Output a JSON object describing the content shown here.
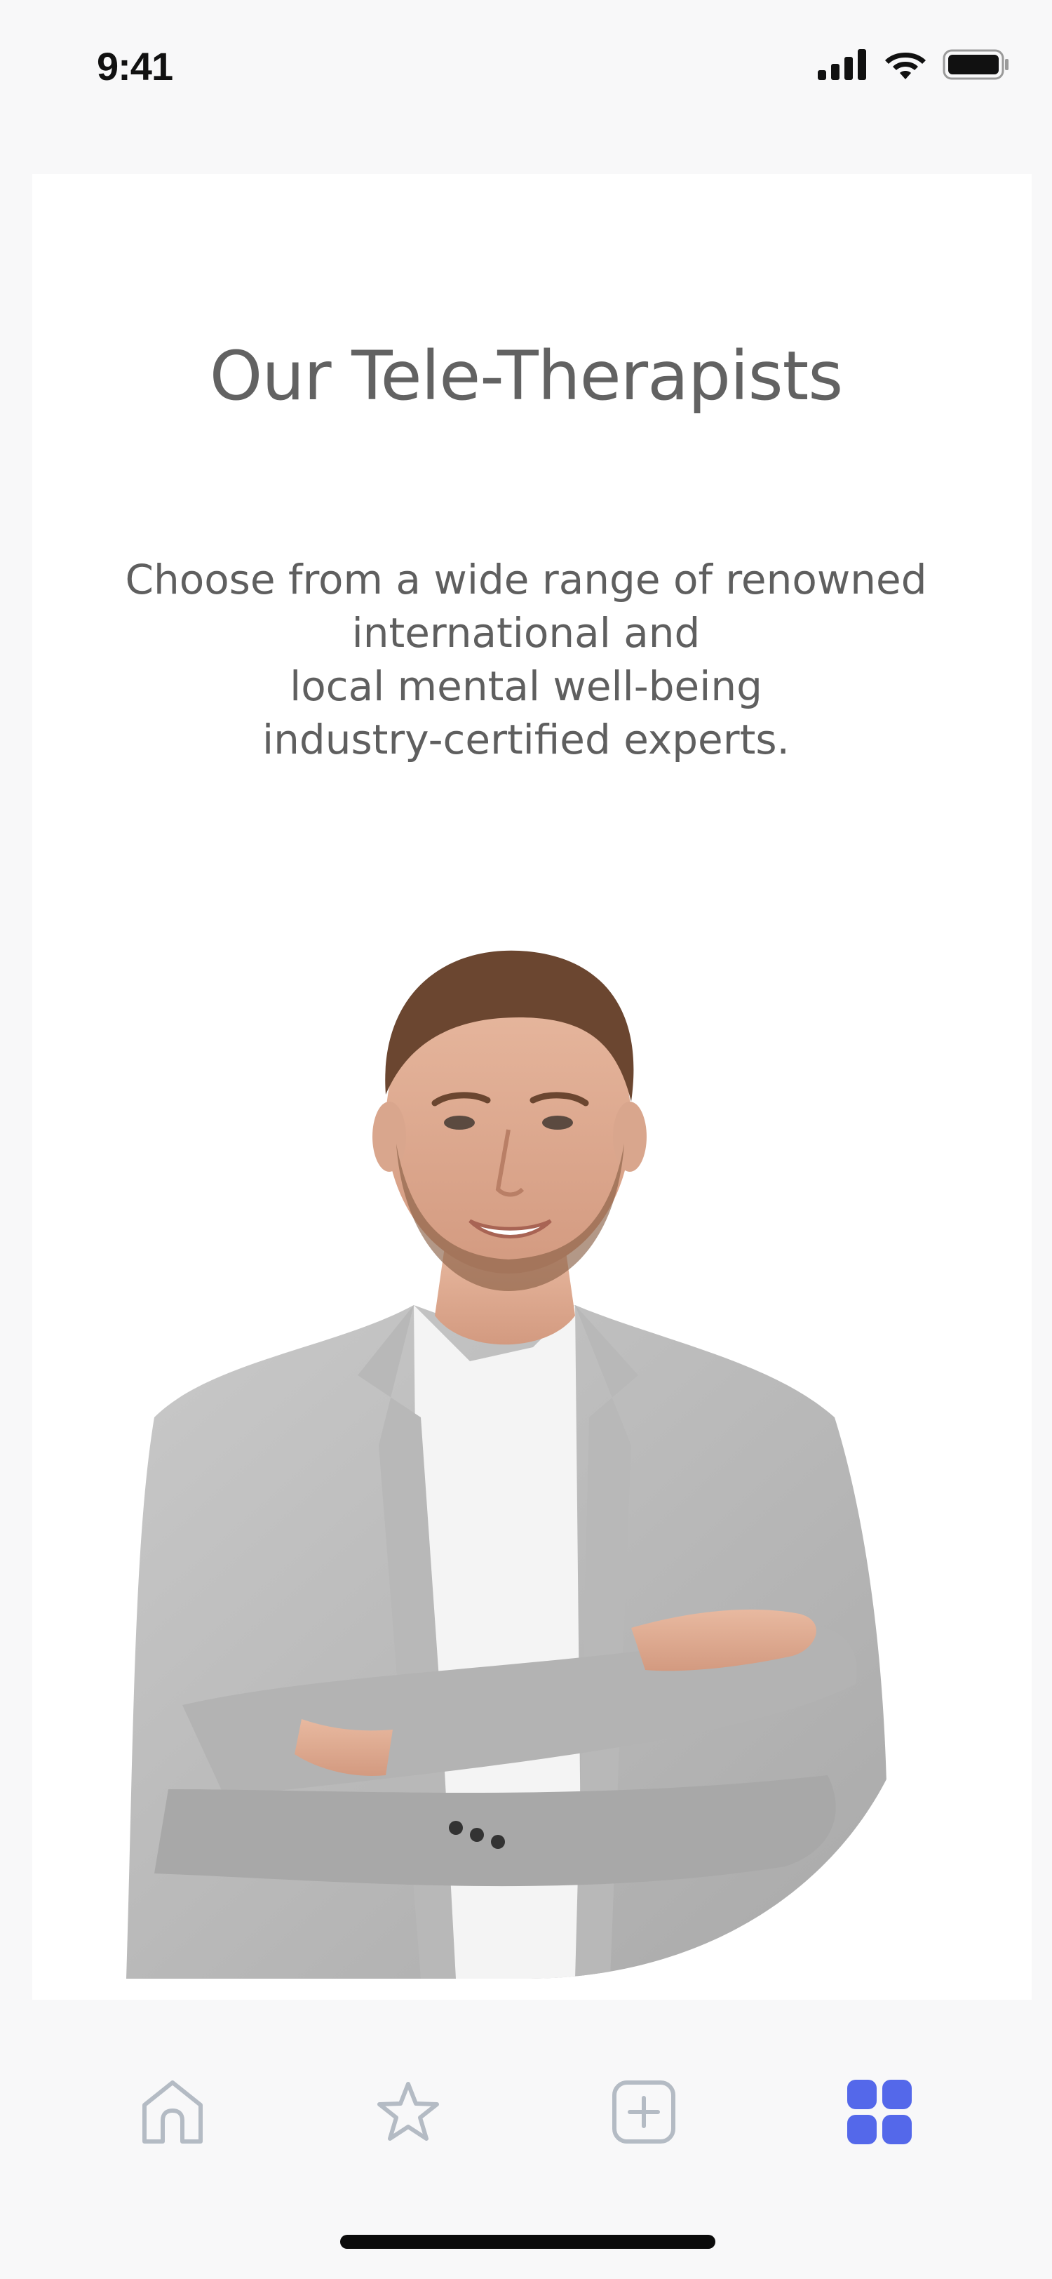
{
  "status_bar": {
    "time": "9:41",
    "icons": [
      "cellular-signal-icon",
      "wifi-icon",
      "battery-icon"
    ]
  },
  "content": {
    "title": "Our Tele-Therapists",
    "subtitle_lines": [
      "Choose from a wide range of renowned",
      "international and",
      "local mental well-being",
      "industry-certified experts."
    ],
    "image": "therapist-portrait"
  },
  "bottom_nav": {
    "items": [
      {
        "icon": "home-icon",
        "active": false
      },
      {
        "icon": "star-icon",
        "active": false
      },
      {
        "icon": "add-square-icon",
        "active": false
      },
      {
        "icon": "grid-icon",
        "active": true
      }
    ],
    "active_color": "#5468ea",
    "inactive_color": "#b4bbc4"
  }
}
